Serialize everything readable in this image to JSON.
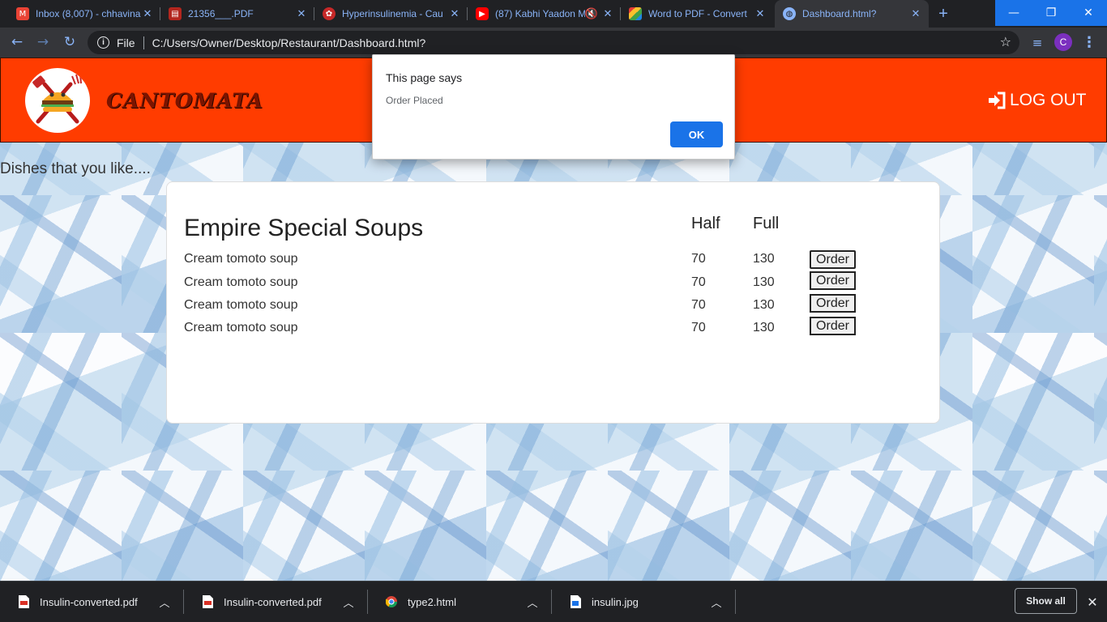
{
  "browser": {
    "tabs": [
      {
        "title": "Inbox (8,007) - chhavina",
        "icon": "gmail-icon",
        "color": "#ea4335"
      },
      {
        "title": "21356___.PDF",
        "icon": "pdf-icon",
        "color": "#b3261e"
      },
      {
        "title": "Hyperinsulinemia - Cau",
        "icon": "site-icon",
        "color": "#c62828"
      },
      {
        "title": "(87) Kabhi Yaadon M",
        "icon": "youtube-icon",
        "color": "#ff0000"
      },
      {
        "title": "Word to PDF - Convert",
        "icon": "converter-icon",
        "color": "#e53935"
      },
      {
        "title": "Dashboard.html?",
        "icon": "globe-icon",
        "color": "#8ab4f8"
      }
    ],
    "address": {
      "scheme": "File",
      "url": "C:/Users/Owner/Desktop/Restaurant/Dashboard.html?"
    },
    "profile_initial": "C",
    "accent": "#1a73e8"
  },
  "site": {
    "brand": "CANTOMATA",
    "logout_label": "LOG OUT",
    "header_color": "#ff3c00",
    "subtitle": "Dishes that you like...."
  },
  "menu": {
    "section_title": "Empire Special Soups",
    "half_header": "Half",
    "full_header": "Full",
    "items": [
      {
        "name": "Cream tomoto soup",
        "half": "70",
        "full": "130",
        "button": "Order"
      },
      {
        "name": "Cream tomoto soup",
        "half": "70",
        "full": "130",
        "button": "Order"
      },
      {
        "name": "Cream tomoto soup",
        "half": "70",
        "full": "130",
        "button": "Order"
      },
      {
        "name": "Cream tomoto soup",
        "half": "70",
        "full": "130",
        "button": "Order"
      }
    ]
  },
  "dialog": {
    "title": "This page says",
    "message": "Order Placed",
    "ok_label": "OK"
  },
  "downloads": {
    "items": [
      {
        "name": "Insulin-converted.pdf",
        "icon": "pdf-file-icon"
      },
      {
        "name": "Insulin-converted.pdf",
        "icon": "pdf-file-icon"
      },
      {
        "name": "type2.html",
        "icon": "chrome-icon"
      },
      {
        "name": "insulin.jpg",
        "icon": "image-file-icon"
      }
    ],
    "show_all_label": "Show all"
  }
}
